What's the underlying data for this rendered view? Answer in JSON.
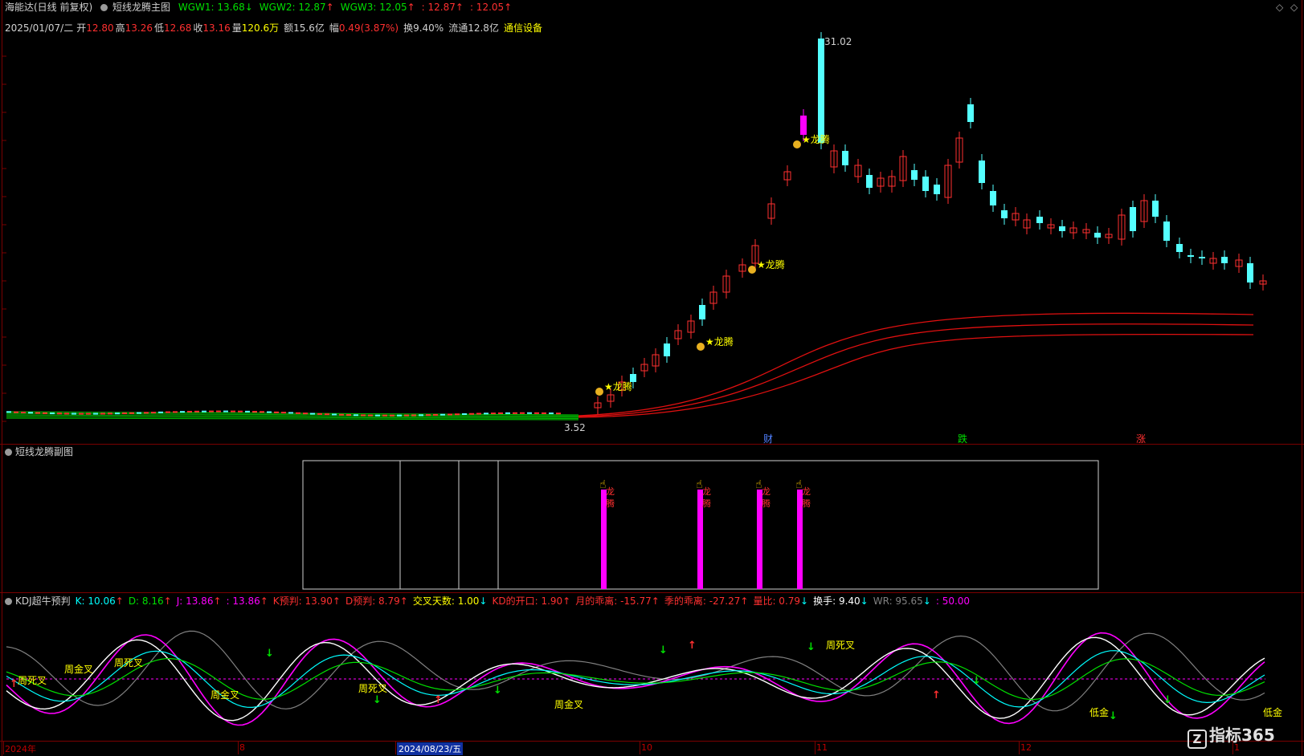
{
  "header": {
    "stock_name": "海能达(日线 前复权)",
    "indicator": "短线龙腾主图",
    "items": [
      {
        "label": "WGW1: 13.68",
        "arrow": "↓",
        "color": "#00e000"
      },
      {
        "label": "WGW2: 12.87",
        "arrow": "↑",
        "color": "#00e000"
      },
      {
        "label": "WGW3: 12.05",
        "arrow": "↑",
        "color": "#00e000"
      },
      {
        "label": ": 12.87",
        "arrow": "↑",
        "color": "#ff3030"
      },
      {
        "label": ": 12.05",
        "arrow": "↑",
        "color": "#ff3030"
      }
    ]
  },
  "quote": {
    "date": "2025/01/07/二",
    "open_label": "开",
    "open": "12.80",
    "high_label": "高",
    "high": "13.26",
    "low_label": "低",
    "low": "12.68",
    "close_label": "收",
    "close": "13.16",
    "vol_label": "量",
    "vol": "120.6万",
    "amt_label": "额",
    "amt": "15.6亿",
    "chg_label": "幅",
    "chg": "0.49(3.87%)",
    "turn_label": "换",
    "turn": "9.40%",
    "float_label": "流通",
    "float": "12.8亿",
    "sector": "通信设备"
  },
  "main_chart": {
    "high_label": "31.02",
    "low_label": "3.52",
    "signal_label": "★龙腾",
    "event_markers": [
      {
        "label": "财",
        "color": "#5080ff"
      },
      {
        "label": "跌",
        "color": "#00e000"
      },
      {
        "label": "涨",
        "color": "#ff3030"
      }
    ]
  },
  "sub_chart": {
    "title": "短线龙腾副图",
    "signal_top": "龙",
    "signal_bottom": "腾"
  },
  "kdj": {
    "title": "KDJ超牛预判",
    "items": [
      {
        "label": "K: 10.06",
        "arrow": "↑",
        "color": "#00ffff"
      },
      {
        "label": "D: 8.16",
        "arrow": "↑",
        "color": "#00e000"
      },
      {
        "label": "J: 13.86",
        "arrow": "↑",
        "color": "#ff00ff"
      },
      {
        "label": ": 13.86",
        "arrow": "↑",
        "color": "#ff00ff"
      },
      {
        "label": "K预判: 13.90",
        "arrow": "↑",
        "color": "#ff3030"
      },
      {
        "label": "D预判: 8.79",
        "arrow": "↑",
        "color": "#ff3030"
      },
      {
        "label": "交叉天数: 1.00",
        "arrow": "↓",
        "color": "#ffff00"
      },
      {
        "label": "KD的开口: 1.90",
        "arrow": "↑",
        "color": "#ff3030"
      },
      {
        "label": "月的乖离: -15.77",
        "arrow": "↑",
        "color": "#ff3030"
      },
      {
        "label": "季的乖离: -27.27",
        "arrow": "↑",
        "color": "#ff3030"
      },
      {
        "label": "量比: 0.79",
        "arrow": "↓",
        "color": "#ff3030"
      },
      {
        "label": "换手: 9.40",
        "arrow": "↓",
        "color": "#ffffff"
      },
      {
        "label": "WR: 95.65",
        "arrow": "↓",
        "color": "#808080"
      },
      {
        "label": ": 50.00",
        "arrow": "",
        "color": "#ff00ff"
      }
    ],
    "annotations": {
      "week_death": "周死叉",
      "week_gold": "周金叉",
      "low_gold": "低金"
    }
  },
  "xaxis": {
    "labels": [
      "2024年",
      "8",
      "2024/08/23/五",
      "10",
      "11",
      "12",
      "1"
    ]
  },
  "watermark": "指标365",
  "window_controls": {
    "restore": "◇",
    "close": "◇"
  }
}
